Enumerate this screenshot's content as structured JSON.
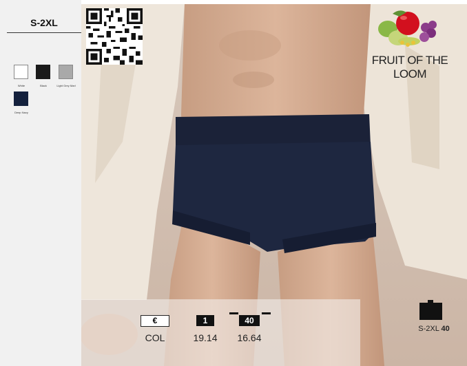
{
  "size_range": "S-2XL",
  "colors": [
    {
      "name": "White",
      "hex": "#ffffff"
    },
    {
      "name": "Black",
      "hex": "#1a1a1a"
    },
    {
      "name": "Light Grey Marl",
      "hex": "#a9a9a9"
    },
    {
      "name": "Deep Navy",
      "hex": "#14213d"
    }
  ],
  "brand": {
    "name": "FRUIT OF THE LOOM"
  },
  "pricing": {
    "currency_symbol": "€",
    "currency_label": "COL",
    "qty_single": "1",
    "price_single": "19.14",
    "qty_carton": "40",
    "price_carton": "16.64"
  },
  "carton": {
    "size": "S-2XL",
    "qty": "40"
  }
}
